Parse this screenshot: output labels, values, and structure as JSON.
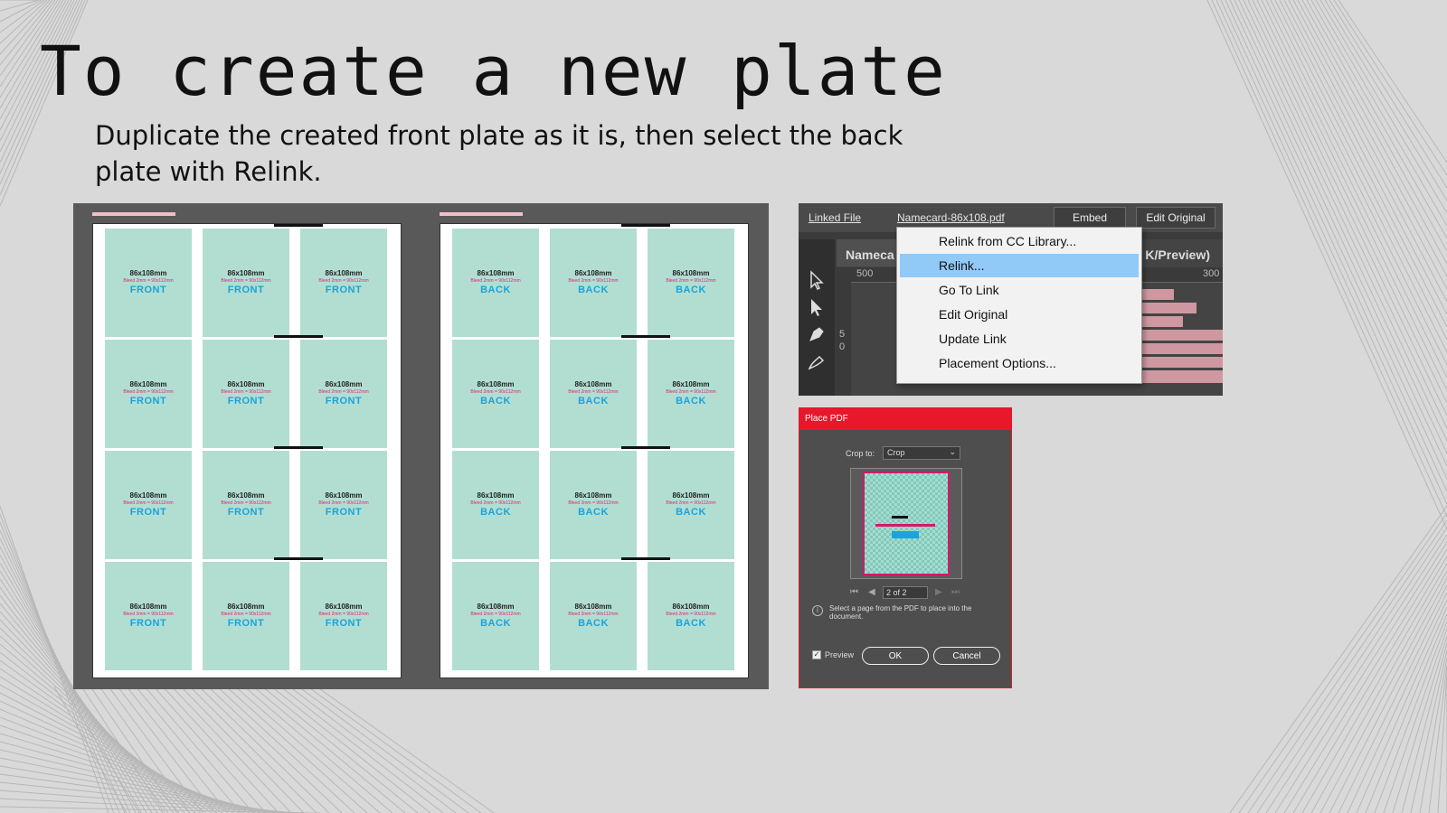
{
  "slide": {
    "title": "To create a new plate",
    "subtitle": "Duplicate the created front plate as it is, then select the back plate with Relink."
  },
  "plates": {
    "card_dimension": "86x108mm",
    "card_bleed": "Bleed 2mm = 90x112mm",
    "front_label": "FRONT",
    "back_label": "BACK",
    "rows": 4,
    "columns": 3
  },
  "links_panel": {
    "linked_file_label": "Linked File",
    "file_name": "Namecard-86x108.pdf",
    "embed_button": "Embed",
    "edit_original_button": "Edit Original",
    "doc_tab": "Nameca",
    "doc_tab_suffix": "K/Preview)",
    "ruler_values": [
      "500",
      "300"
    ],
    "vruler_values": [
      "5",
      "0"
    ]
  },
  "context_menu": {
    "items": [
      "Relink from CC Library...",
      "Relink...",
      "Go To Link",
      "Edit Original",
      "Update Link",
      "Placement Options..."
    ],
    "active_index": 1
  },
  "place_pdf_dialog": {
    "title": "Place PDF",
    "crop_label": "Crop to:",
    "crop_value": "Crop",
    "page_value": "2 of 2",
    "info_text_1": "Select a page from the PDF to place into the",
    "info_text_2": "document.",
    "preview_label": "Preview",
    "preview_checked": true,
    "ok_button": "OK",
    "cancel_button": "Cancel"
  },
  "colors": {
    "card_fill": "#b2ded2",
    "card_side_text": "#1aa3dc",
    "bleed_text": "#e0247a",
    "menu_highlight": "#91c9f7",
    "dialog_accent": "#e8172b"
  }
}
